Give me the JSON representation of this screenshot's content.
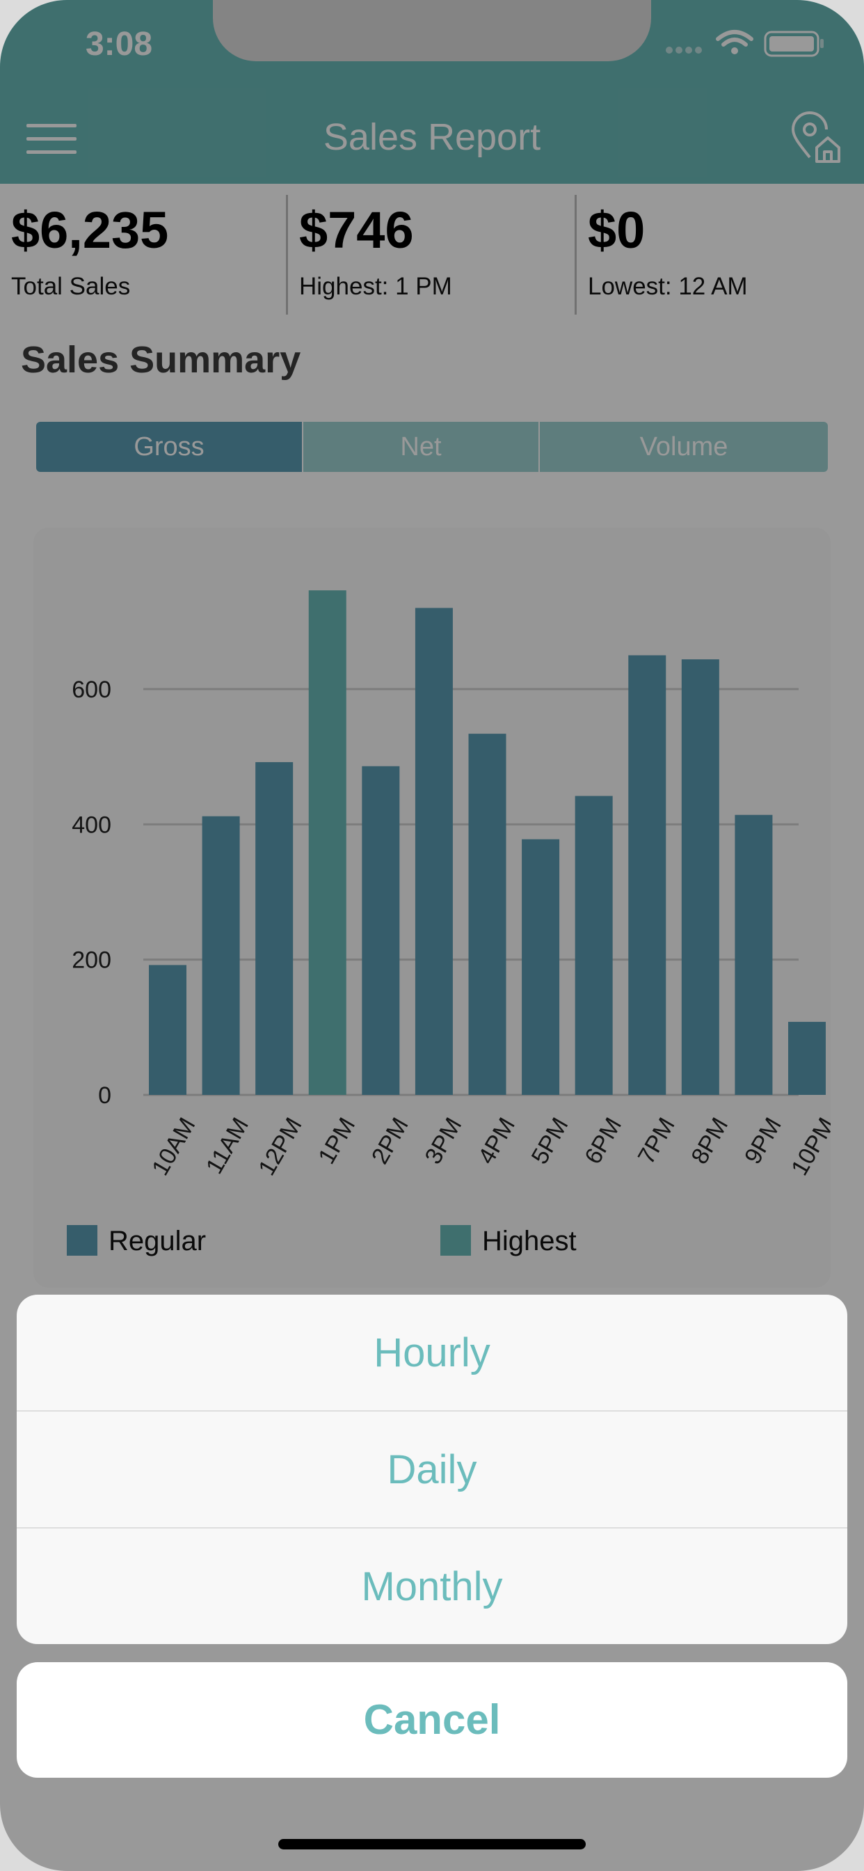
{
  "status_bar": {
    "time": "3:08"
  },
  "header": {
    "title": "Sales Report"
  },
  "stats": [
    {
      "value": "$6,235",
      "label": "Total Sales"
    },
    {
      "value": "$746",
      "label": "Highest: 1 PM"
    },
    {
      "value": "$0",
      "label": "Lowest: 12 AM"
    }
  ],
  "section_title": "Sales Summary",
  "segmented": {
    "items": [
      "Gross",
      "Net",
      "Volume"
    ],
    "selected": "Gross"
  },
  "colors": {
    "header": "#6ab9b8",
    "regular_bar": "#5a9cb2",
    "highest_bar": "#6ab9b8",
    "segment_selected": "#5a9cb2",
    "segment_unselected": "#9dd1d0",
    "action_text": "#6bbcbc"
  },
  "chart_data": {
    "type": "bar",
    "categories": [
      "10AM",
      "11AM",
      "12PM",
      "1PM",
      "2PM",
      "3PM",
      "4PM",
      "5PM",
      "6PM",
      "7PM",
      "8PM",
      "9PM",
      "10PM"
    ],
    "values": [
      192,
      412,
      492,
      746,
      486,
      720,
      534,
      378,
      442,
      650,
      644,
      414,
      108
    ],
    "highlight_index": 3,
    "yticks": [
      0,
      200,
      400,
      600
    ],
    "ylim": [
      0,
      780
    ],
    "grid": true,
    "legend": [
      {
        "label": "Regular"
      },
      {
        "label": "Highest"
      }
    ],
    "legend_position": "bottom"
  },
  "action_sheet": {
    "options": [
      "Hourly",
      "Daily",
      "Monthly"
    ],
    "cancel_label": "Cancel"
  }
}
